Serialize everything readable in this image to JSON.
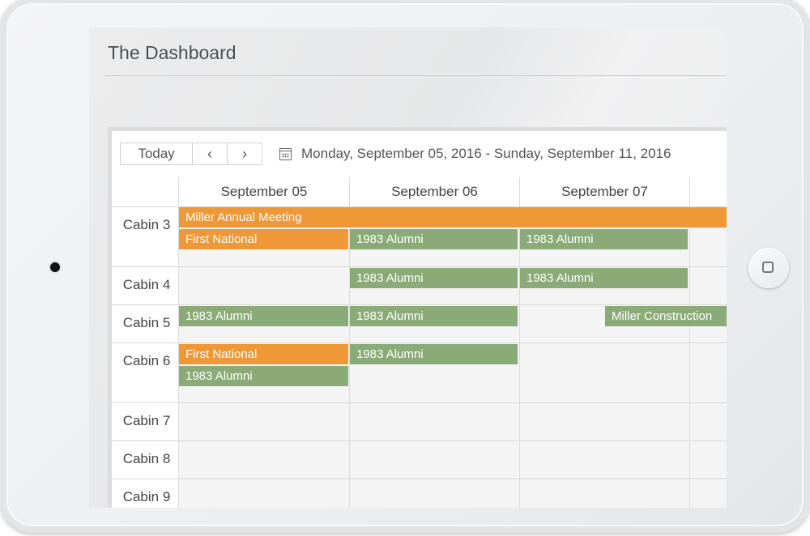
{
  "page_title": "The Dashboard",
  "toolbar": {
    "today_label": "Today",
    "prev_label": "‹",
    "next_label": "›",
    "date_range": "Monday, September 05, 2016 - Sunday, September 11, 2016"
  },
  "days": [
    "September 05",
    "September 06",
    "September 07"
  ],
  "resources": [
    {
      "name": "Cabin 3"
    },
    {
      "name": "Cabin 4"
    },
    {
      "name": "Cabin 5"
    },
    {
      "name": "Cabin 6"
    },
    {
      "name": "Cabin 7"
    },
    {
      "name": "Cabin 8"
    },
    {
      "name": "Cabin 9"
    }
  ],
  "events": [
    {
      "resource": "Cabin 3",
      "title": "Miller Annual Meeting",
      "color": "#ee9838"
    },
    {
      "resource": "Cabin 3",
      "title": "First National",
      "color": "#ee9838"
    },
    {
      "resource": "Cabin 3",
      "title": "1983 Alumni",
      "color": "#8aab77"
    },
    {
      "resource": "Cabin 3",
      "title": "1983 Alumni",
      "color": "#8aab77"
    },
    {
      "resource": "Cabin 4",
      "title": "1983 Alumni",
      "color": "#8aab77"
    },
    {
      "resource": "Cabin 4",
      "title": "1983 Alumni",
      "color": "#8aab77"
    },
    {
      "resource": "Cabin 5",
      "title": "1983 Alumni",
      "color": "#8aab77"
    },
    {
      "resource": "Cabin 5",
      "title": "1983 Alumni",
      "color": "#8aab77"
    },
    {
      "resource": "Cabin 5",
      "title": "Miller Construction",
      "color": "#8aab77"
    },
    {
      "resource": "Cabin 6",
      "title": "First National",
      "color": "#ee9838"
    },
    {
      "resource": "Cabin 6",
      "title": "1983 Alumni",
      "color": "#8aab77"
    },
    {
      "resource": "Cabin 6",
      "title": "1983 Alumni",
      "color": "#8aab77"
    }
  ],
  "colors": {
    "orange_event": "#ee9838",
    "green_event": "#8aab77"
  }
}
